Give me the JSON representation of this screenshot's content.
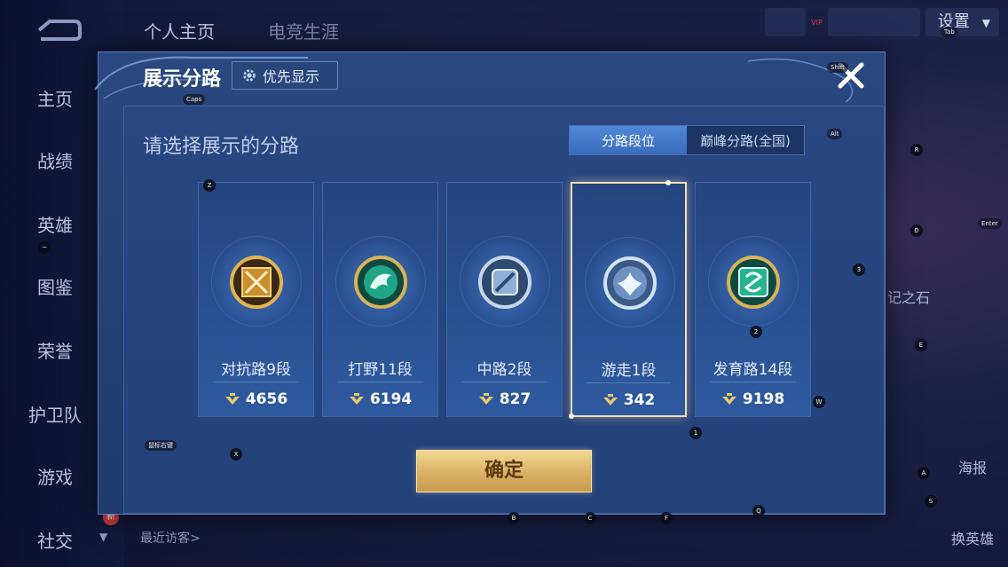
{
  "background": {
    "nav_items": [
      {
        "label": "主页"
      },
      {
        "label": "战绩"
      },
      {
        "label": "英雄"
      },
      {
        "label": "图鉴"
      },
      {
        "label": "荣誉"
      },
      {
        "label": "护卫队"
      },
      {
        "label": "游戏"
      },
      {
        "label": "社交"
      }
    ],
    "top_tabs": [
      "个人主页",
      "电竞生涯"
    ],
    "settings_label": "设置",
    "vip_label": "VIP",
    "new_badge": "新",
    "recent_visitors": "最近访客>",
    "right_items": {
      "stone": "记之石",
      "poster": "海报",
      "swap_hero": "换英雄"
    }
  },
  "modal": {
    "title": "展示分路",
    "priority_button": "优先显示",
    "subtitle": "请选择展示的分路",
    "toggle": {
      "active": "分路段位",
      "inactive": "巅峰分路(全国)"
    },
    "cards": [
      {
        "label": "对抗路9段",
        "score": "4656",
        "selected": false,
        "color": "#d9a441"
      },
      {
        "label": "打野11段",
        "score": "6194",
        "selected": false,
        "color": "#2bb59a"
      },
      {
        "label": "中路2段",
        "score": "827",
        "selected": false,
        "color": "#aac4e6"
      },
      {
        "label": "游走1段",
        "score": "342",
        "selected": true,
        "color": "#c4d8f2"
      },
      {
        "label": "发育路14段",
        "score": "9198",
        "selected": false,
        "color": "#2fc6a0"
      }
    ],
    "confirm": "确定"
  },
  "key_hints": {
    "caps": "Caps",
    "shift": "Shift",
    "tab": "Tab",
    "alt": "Alt",
    "enter": "Enter",
    "tilde": "~",
    "z": "Z",
    "r": "R",
    "d": "D",
    "three": "3",
    "two": "2",
    "e": "E",
    "w": "W",
    "one": "1",
    "x": "X",
    "a": "A",
    "s": "S",
    "b": "B",
    "c": "C",
    "f": "F",
    "q": "Q",
    "wheel": "鼠标右键"
  }
}
